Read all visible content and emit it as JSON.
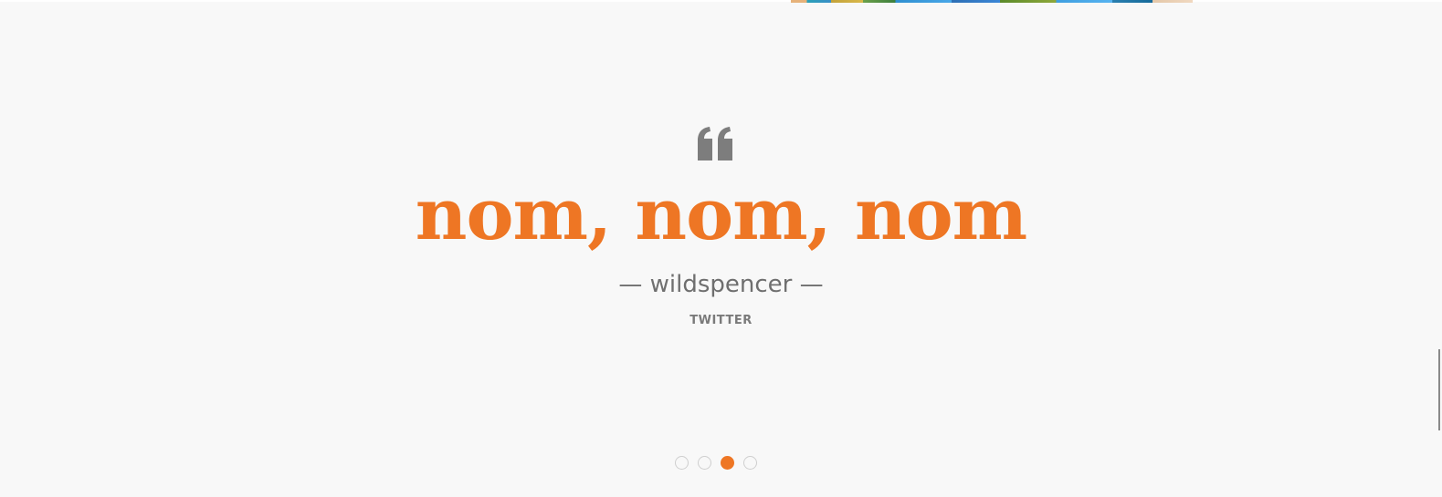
{
  "testimonial": {
    "quote": "nom, nom, nom",
    "author": "— wildspencer —",
    "source": "TWITTER",
    "quote_icon": "quote-left-icon"
  },
  "carousel": {
    "slides": 4,
    "active_index": 2,
    "accent_color": "#ee7624"
  }
}
